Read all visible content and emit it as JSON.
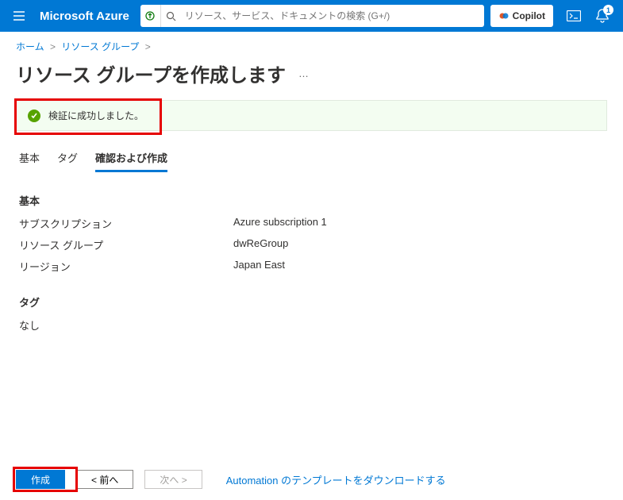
{
  "header": {
    "logo": "Microsoft Azure",
    "search_placeholder": "リソース、サービス、ドキュメントの検索 (G+/)",
    "copilot": "Copilot",
    "notification_count": "1"
  },
  "breadcrumb": {
    "home": "ホーム",
    "group": "リソース グループ"
  },
  "title": "リソース グループを作成します",
  "validation_msg": "検証に成功しました。",
  "tabs": {
    "basic": "基本",
    "tags": "タグ",
    "review": "確認および作成"
  },
  "sections": {
    "basic": {
      "title": "基本",
      "rows": [
        {
          "k": "サブスクリプション",
          "v": "Azure subscription 1"
        },
        {
          "k": "リソース グループ",
          "v": "dwReGroup"
        },
        {
          "k": "リージョン",
          "v": "Japan East"
        }
      ]
    },
    "tags": {
      "title": "タグ",
      "none": "なし"
    }
  },
  "footer": {
    "create": "作成",
    "prev": "< 前へ",
    "next": "次へ >",
    "download": "Automation のテンプレートをダウンロードする"
  }
}
